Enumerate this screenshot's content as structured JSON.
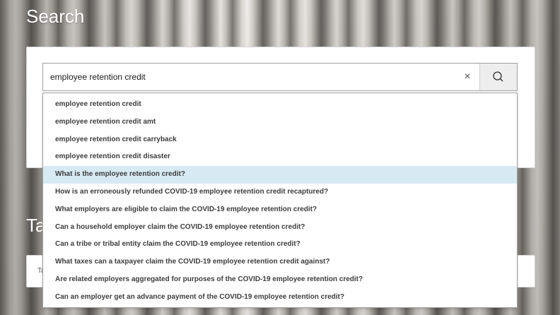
{
  "page": {
    "title": "Search",
    "section_title": "Ta",
    "panel2_text": "Ta"
  },
  "search": {
    "value": "employee retention credit",
    "placeholder": "",
    "clear_icon": "×",
    "search_icon": "search-icon"
  },
  "suggestions": [
    "employee retention credit",
    "employee retention credit amt",
    "employee retention credit carryback",
    "employee retention credit disaster",
    "What is the employee retention credit?",
    "How is an erroneously refunded COVID-19 employee retention credit recaptured?",
    "What employers are eligible to claim the COVID-19 employee retention credit?",
    "Can a household employer claim the COVID-19 employee retention credit?",
    "Can a tribe or tribal entity claim the COVID-19 employee retention credit?",
    "What taxes can a taxpayer claim the COVID-19 employee retention credit against?",
    "Are related employers aggregated for purposes of the COVID-19 employee retention credit?",
    "Can an employer get an advance payment of the COVID-19 employee retention credit?"
  ],
  "highlighted_index": 4,
  "colors": {
    "highlight": "#d7eaf4",
    "suggestion_text": "#3d3d3d"
  }
}
